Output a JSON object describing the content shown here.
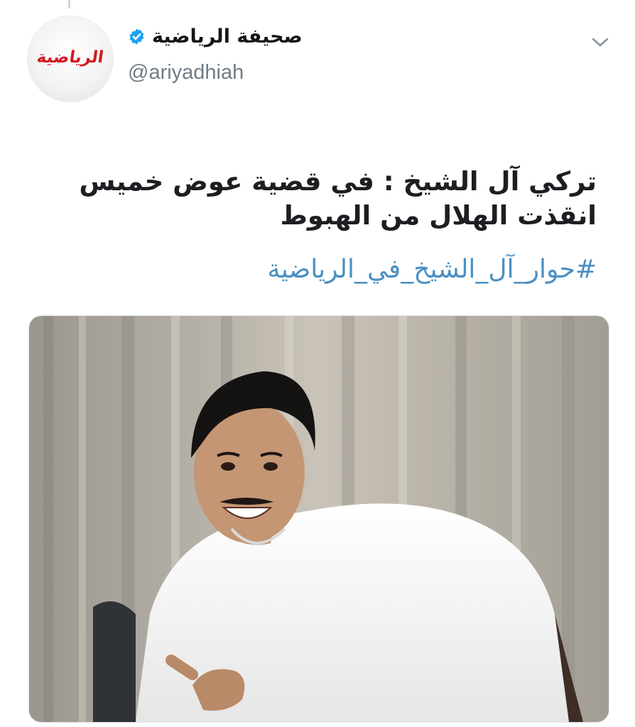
{
  "tweet": {
    "display_name": "صحيفة الرياضية",
    "handle": "@ariyadhiah",
    "avatar_logo_text": "الرياضية",
    "text_line_1": "تركي آل الشيخ : في قضية عوض خميس",
    "text_line_2": "انقذت الهلال من الهبوط",
    "hashtag": "#حوار_آل_الشيخ_في_الرياضية",
    "verified": true,
    "media_description": "photo of a smiling man in a white thobe pointing, seated in front of curtains"
  },
  "icons": {
    "verified": "verified-badge-icon",
    "menu": "chevron-down-icon"
  },
  "colors": {
    "verified_blue": "#1da1f2",
    "hashtag_blue": "#4a90c2",
    "logo_red": "#d3191f",
    "handle_gray": "#6e7c87"
  }
}
